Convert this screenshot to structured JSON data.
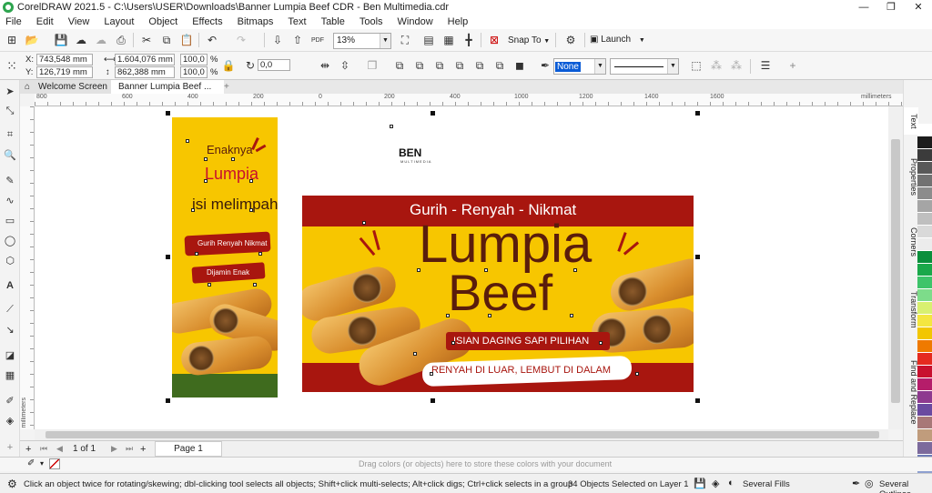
{
  "window": {
    "title": "CorelDRAW 2021.5 - C:\\Users\\USER\\Downloads\\Banner Lumpia Beef CDR - Ben Multimedia.cdr",
    "minimize": "—",
    "maximize": "❐",
    "close": "✕"
  },
  "menu": [
    "File",
    "Edit",
    "View",
    "Layout",
    "Object",
    "Effects",
    "Bitmaps",
    "Text",
    "Table",
    "Tools",
    "Window",
    "Help"
  ],
  "standard_toolbar": {
    "zoom": "13%",
    "snap_to": "Snap To",
    "launch": "Launch"
  },
  "property_bar": {
    "x_label": "X:",
    "x": "743,548 mm",
    "y_label": "Y:",
    "y": "126,719 mm",
    "width": "1.604,076 mm",
    "height": "862,388 mm",
    "scale_w": "100,0",
    "scale_h": "100,0",
    "pct": "%",
    "rotation": "0,0",
    "outline_fill": "None"
  },
  "tabs": {
    "welcome": "Welcome Screen",
    "document": "Banner Lumpia Beef ...",
    "add": "+"
  },
  "ruler": {
    "unit": "millimeters",
    "h_ticks": [
      "800",
      "600",
      "400",
      "200",
      "0",
      "200",
      "400",
      "600",
      "800",
      "1000",
      "1200",
      "1400",
      "1600"
    ],
    "v_unit": "millimeters"
  },
  "design": {
    "logo": "BEN",
    "logo_sub": "MULTIMEDIA",
    "vertical": {
      "line1": "Enaknya",
      "line2": "Lumpia",
      "line3": "isi melimpah",
      "line4": "Gurih Renyah Nikmat",
      "line5": "Dijamin Enak"
    },
    "horizontal": {
      "tagline": "Gurih - Renyah - Nikmat",
      "title1": "Lumpia",
      "title2": "Beef",
      "sub1": "ISIAN DAGING SAPI PILIHAN",
      "sub2": "RENYAH DI LUAR, LEMBUT DI DALAM"
    }
  },
  "docker_tabs": [
    "Text",
    "Properties",
    "Corners",
    "Transform",
    "Find and Replace"
  ],
  "page_nav": {
    "of": "1 of 1",
    "page": "Page 1"
  },
  "colorwell": {
    "hint": "Drag colors (or objects) here to store these colors with your document"
  },
  "status": {
    "hint": "Click an object twice for rotating/skewing; dbl-clicking tool selects all objects; Shift+click multi-selects; Alt+click digs; Ctrl+click selects in a group",
    "selection": "34 Objects Selected on Layer 1",
    "fill": "Several Fills",
    "outline": "Several Outlines"
  },
  "colors": {
    "banner_red": "#a8160f",
    "banner_yellow": "#f7c600",
    "title_brown": "#5a1d0c"
  },
  "palette": [
    "#ffffff",
    "#1c1c1c",
    "#3b3b3b",
    "#595959",
    "#727272",
    "#8c8c8c",
    "#a5a5a5",
    "#bfbfbf",
    "#d9d9d9",
    "#ececec",
    "#0a8f3c",
    "#1aa84a",
    "#3ec46a",
    "#7ddc8a",
    "#d8f070",
    "#f4e640",
    "#f2c600",
    "#ef7a00",
    "#e52a1f",
    "#c8102e",
    "#b51d6a",
    "#8e3a8f",
    "#6a4aa0",
    "#a87878",
    "#c09c7c",
    "#7c6a9c",
    "#6e7cb8",
    "#8ea0d0",
    "#5a6ab0",
    "#4a4a8a"
  ]
}
